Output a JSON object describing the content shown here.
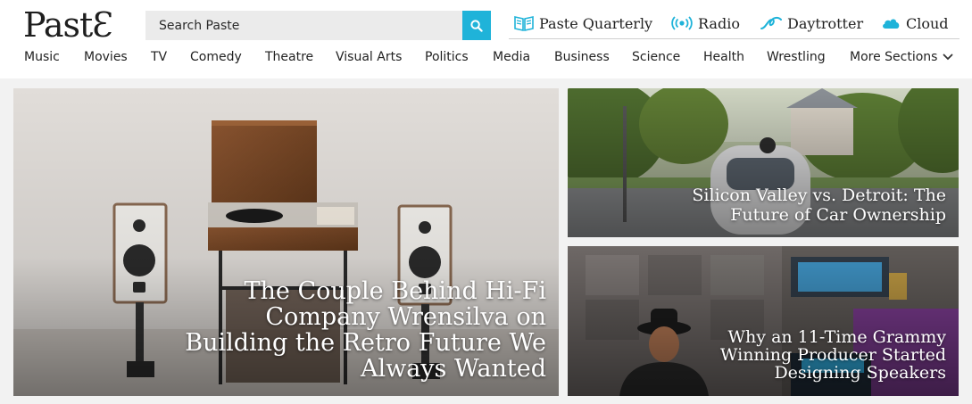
{
  "brand": {
    "logo_text": "PastƐ"
  },
  "search": {
    "placeholder": "Search Paste"
  },
  "top_links": [
    {
      "label": "Paste Quarterly",
      "icon": "open-book-icon"
    },
    {
      "label": "Radio",
      "icon": "broadcast-icon"
    },
    {
      "label": "Daytrotter",
      "icon": "daytrotter-icon"
    },
    {
      "label": "Cloud",
      "icon": "cloud-icon"
    }
  ],
  "nav": {
    "items": [
      "Music",
      "Movies",
      "TV",
      "Comedy",
      "Theatre",
      "Visual Arts",
      "Politics",
      "Media",
      "Business",
      "Science",
      "Health",
      "Wrestling"
    ],
    "more_label": "More Sections"
  },
  "stories": {
    "main": {
      "title": "The Couple Behind Hi-Fi Company Wrensilva on Building the Retro Future We Always Wanted"
    },
    "top_right": {
      "title": "Silicon Valley vs. Detroit: The Future of Car Ownership"
    },
    "bottom_right": {
      "title": "Why an 11-Time Grammy Winning Producer Started Designing Speakers"
    }
  },
  "colors": {
    "accent": "#1fb3d9",
    "text": "#222222",
    "background": "#f2f2f2"
  }
}
